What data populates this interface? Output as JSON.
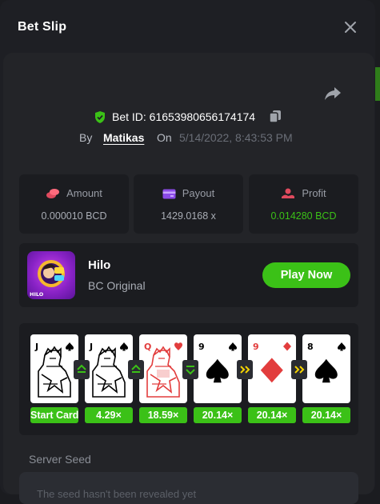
{
  "modal": {
    "title": "Bet Slip"
  },
  "bet": {
    "id_label": "Bet ID: 61653980656174174",
    "by_label": "By",
    "user": "Matikas",
    "on_label": "On",
    "date": "5/14/2022, 8:43:53 PM"
  },
  "stats": [
    {
      "label": "Amount",
      "value": "0.000010 BCD",
      "icon": "coins-icon"
    },
    {
      "label": "Payout",
      "value": "1429.0168 x",
      "icon": "wallet-icon"
    },
    {
      "label": "Profit",
      "value": "0.014280 BCD",
      "icon": "profit-icon"
    }
  ],
  "game": {
    "name": "Hilo",
    "subtitle": "BC Original",
    "play_label": "Play Now",
    "icon_text": "HILO"
  },
  "cards": [
    {
      "rank": "J",
      "suit": "spade",
      "color": "#000000",
      "multiplier": "Start Card",
      "move": "start"
    },
    {
      "rank": "J",
      "suit": "spade",
      "color": "#000000",
      "multiplier": "4.29×",
      "move": "higher"
    },
    {
      "rank": "Q",
      "suit": "heart",
      "color": "#e23d3d",
      "multiplier": "18.59×",
      "move": "higher"
    },
    {
      "rank": "9",
      "suit": "spade",
      "color": "#000000",
      "multiplier": "20.14×",
      "move": "lower"
    },
    {
      "rank": "9",
      "suit": "diamond",
      "color": "#e23d3d",
      "multiplier": "20.14×",
      "move": "skip"
    },
    {
      "rank": "8",
      "suit": "spade",
      "color": "#000000",
      "multiplier": "20.14×",
      "move": "skip"
    }
  ],
  "seed": {
    "label": "Server Seed",
    "placeholder": "The seed hasn't been revealed yet"
  },
  "colors": {
    "accent_green": "#3bc117",
    "panel": "#232428",
    "card_red": "#e23d3d"
  }
}
